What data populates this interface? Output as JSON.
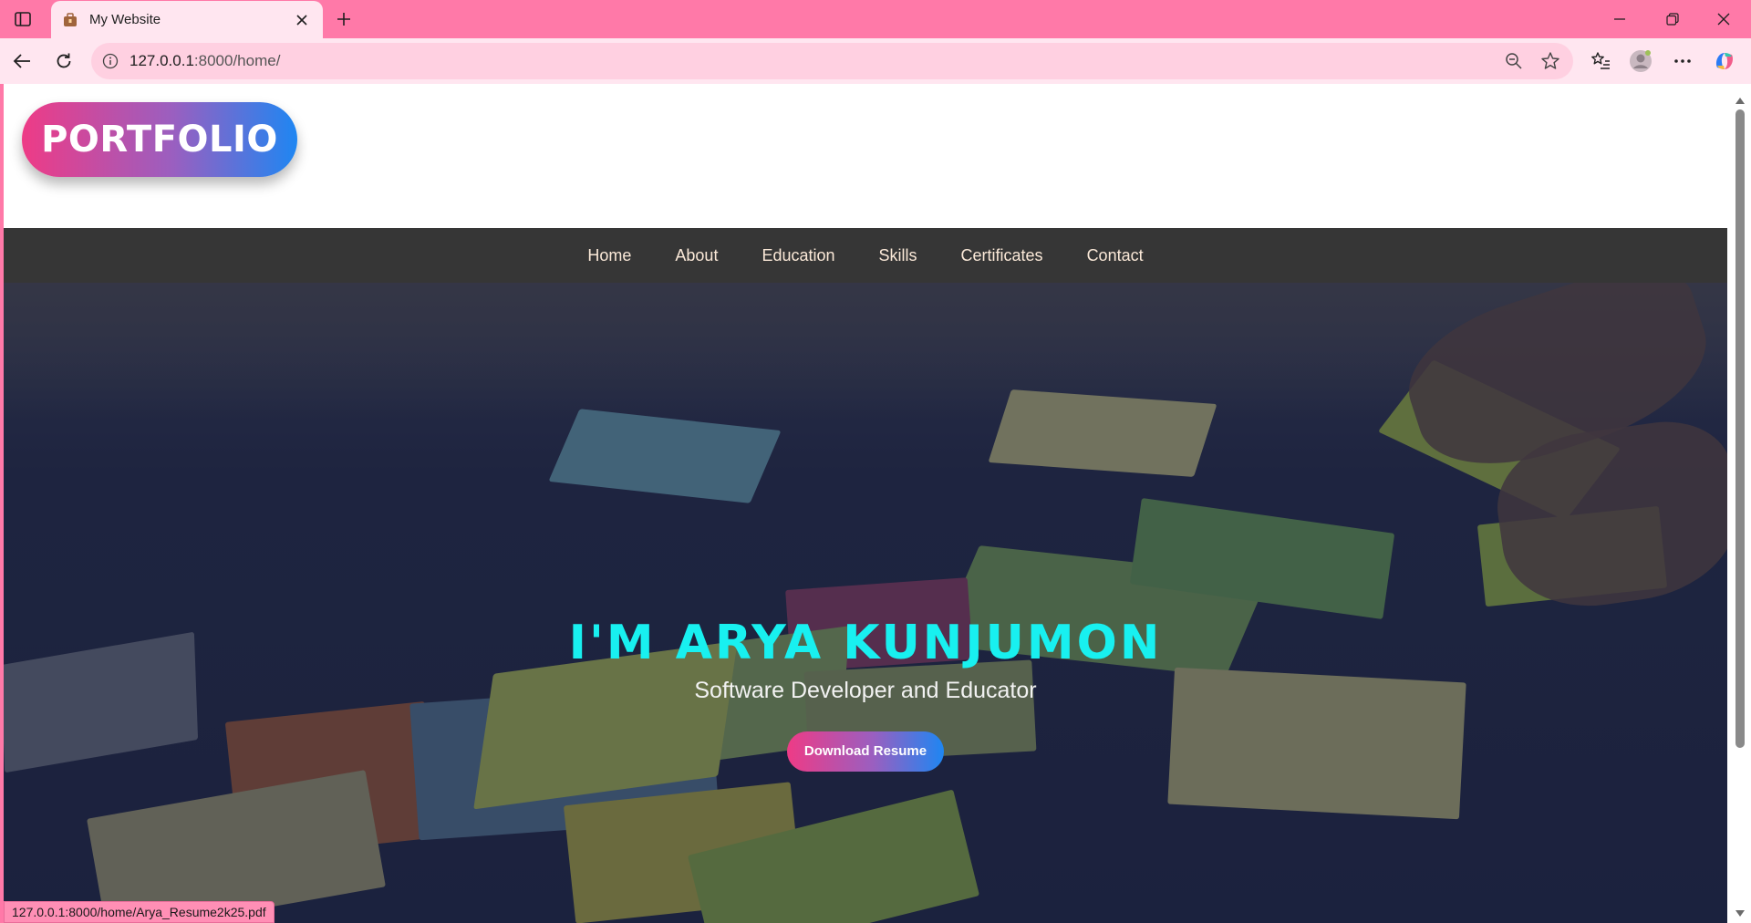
{
  "browser": {
    "tab_title": "My Website",
    "url_host": "127.0.0.1",
    "url_path": ":8000/home/",
    "status_url": "127.0.0.1:8000/home/Arya_Resume2k25.pdf"
  },
  "site": {
    "logo": "PORTFOLIO",
    "nav": [
      "Home",
      "About",
      "Education",
      "Skills",
      "Certificates",
      "Contact"
    ],
    "hero_name": "I'M ARYA KUNJUMON",
    "hero_subtitle": "Software Developer and Educator",
    "cta_label": "Download Resume"
  },
  "colors": {
    "chrome": "#ff79a8",
    "accent_start": "#ee3b86",
    "accent_end": "#1e86f2",
    "hero_title": "#18f0f0",
    "navbar": "#363636"
  }
}
